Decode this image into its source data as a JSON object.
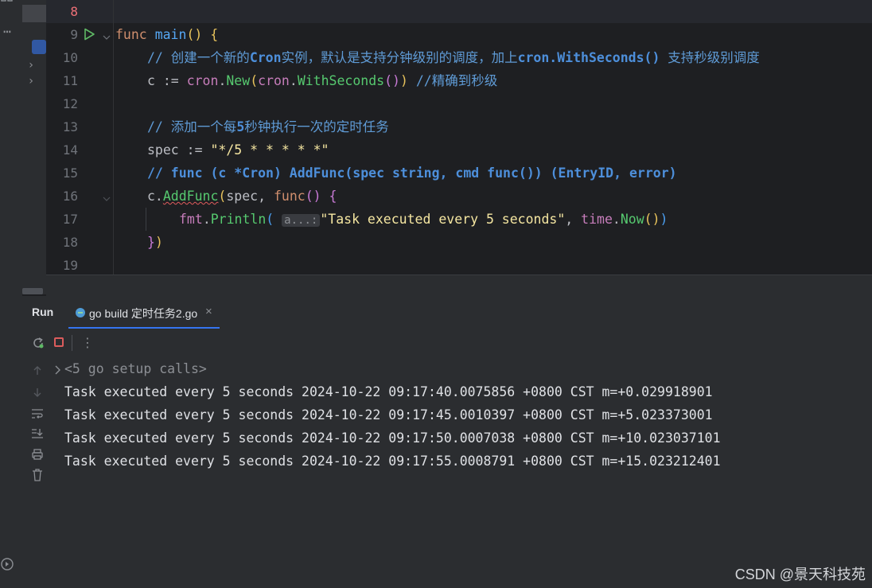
{
  "editor": {
    "lines": [
      {
        "num": "8"
      },
      {
        "num": "9"
      },
      {
        "num": "10"
      },
      {
        "num": "11"
      },
      {
        "num": "12"
      },
      {
        "num": "13"
      },
      {
        "num": "14"
      },
      {
        "num": "15"
      },
      {
        "num": "16"
      },
      {
        "num": "17"
      },
      {
        "num": "18"
      },
      {
        "num": "19"
      }
    ],
    "l9": {
      "kw": "func",
      "name": "main",
      "paren": "()",
      "brace": "{"
    },
    "l10": {
      "comment_a": "// 创建一个新的",
      "cron": "Cron",
      "comment_b": "实例，默认是支持分钟级别的调度，加上",
      "ws": "cron.WithSeconds()",
      "comment_c": " 支持秒级别调度"
    },
    "l11": {
      "var": "c :=",
      "pkg1": "cron",
      "dot1": ".",
      "fn1": "New",
      "open1": "(",
      "pkg2": "cron",
      "dot2": ".",
      "fn2": "WithSeconds",
      "open2": "()",
      "close1": ")",
      "comment": " //精确到秒级"
    },
    "l13": {
      "comment_a": "// 添加一个每",
      "num": "5",
      "comment_b": "秒钟执行一次的定时任务"
    },
    "l14": {
      "lhs": "spec :=",
      "str": "\"*/5 * * * * *\""
    },
    "l15": {
      "comment": "// func (c *Cron) AddFunc(spec string, cmd func()) (EntryID, error)"
    },
    "l16": {
      "recv": "c.",
      "fn": "AddFunc",
      "open": "(",
      "arg": "spec, ",
      "kw": "func",
      "paren": "()",
      "brace": "{"
    },
    "l17": {
      "pkg": "fmt",
      "dot": ".",
      "fn": "Println",
      "open": "(",
      "hint": "a...:",
      "str": "\"Task executed every 5 seconds\"",
      "comma": ", ",
      "pkg2": "time",
      "dot2": ".",
      "fn2": "Now",
      "call": "()",
      "close": ")"
    },
    "l18": {
      "brace": "}",
      "paren": ")"
    }
  },
  "run_panel": {
    "title": "Run",
    "tab_label": "go build 定时任务2.go",
    "close": "×",
    "more": "⋮",
    "setup": "<5 go setup calls>",
    "output": [
      "Task executed every 5 seconds 2024-10-22 09:17:40.0075856 +0800 CST m=+0.029918901",
      "Task executed every 5 seconds 2024-10-22 09:17:45.0010397 +0800 CST m=+5.023373001",
      "Task executed every 5 seconds 2024-10-22 09:17:50.0007038 +0800 CST m=+10.023037101",
      "Task executed every 5 seconds 2024-10-22 09:17:55.0008791 +0800 CST m=+15.023212401"
    ]
  },
  "watermark": "CSDN @景天科技苑",
  "left_strip": {
    "more": "⋯"
  },
  "colors": {
    "accent": "#56a8f5",
    "stop": "#db5c5c",
    "run_green": "#5fb865"
  }
}
